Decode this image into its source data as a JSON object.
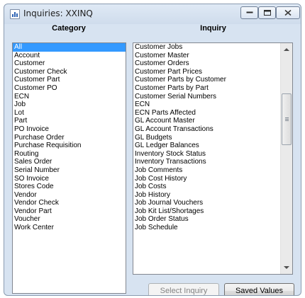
{
  "window": {
    "title": "Inquiries: XXINQ"
  },
  "category": {
    "header": "Category",
    "selected_index": 0,
    "items": [
      "All",
      "Account",
      "Customer",
      "Customer Check",
      "Customer Part",
      "Customer PO",
      "ECN",
      "Job",
      "Lot",
      "Part",
      "PO Invoice",
      "Purchase Order",
      "Purchase Requisition",
      "Routing",
      "Sales Order",
      "Serial Number",
      "SO Invoice",
      "Stores Code",
      "Vendor",
      "Vendor Check",
      "Vendor Part",
      "Voucher",
      "Work Center"
    ]
  },
  "inquiry": {
    "header": "Inquiry",
    "items": [
      "Customer Jobs",
      "Customer Master",
      "Customer Orders",
      "Customer Part Prices",
      "Customer Parts by Customer",
      "Customer Parts by Part",
      "Customer Serial Numbers",
      "ECN",
      "ECN Parts Affected",
      "GL Account Master",
      "GL Account Transactions",
      "GL Budgets",
      "GL Ledger Balances",
      "Inventory Stock Status",
      "Inventory Transactions",
      "Job Comments",
      "Job Cost History",
      "Job Costs",
      "Job History",
      "Job Journal Vouchers",
      "Job Kit List/Shortages",
      "Job Order Status",
      "Job Schedule"
    ]
  },
  "buttons": {
    "select_inquiry": "Select Inquiry",
    "saved_values": "Saved Values"
  },
  "icons": {
    "window": "window-app-icon",
    "minimize": "minimize-icon",
    "maximize": "maximize-icon",
    "close": "close-icon"
  }
}
